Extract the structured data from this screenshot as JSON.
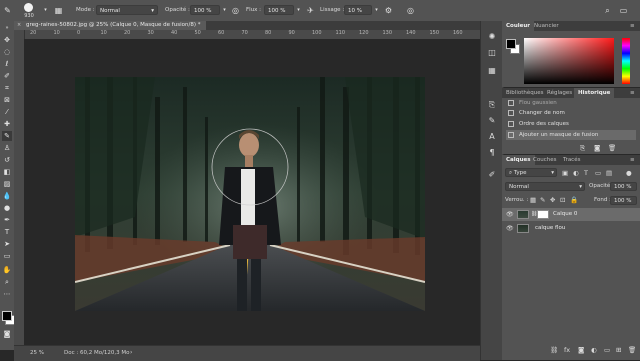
{
  "options_bar": {
    "brush_size": "930",
    "mode_label": "Mode :",
    "mode_value": "Normal",
    "opacity_label": "Opacité :",
    "opacity_value": "100 %",
    "flow_label": "Flux :",
    "flow_value": "100 %",
    "smoothing_label": "Lissage :",
    "smoothing_value": "10 %"
  },
  "document": {
    "tab_title": "greg-raines-50802.jpg @ 25% (Calque 0, Masque de fusion/8) *",
    "zoom": "25 %",
    "doc_info": "Doc : 60,2 Mo/120,3 Mo"
  },
  "ruler": {
    "ticks": [
      "20",
      "10",
      "0",
      "10",
      "20",
      "30",
      "40",
      "50",
      "60",
      "70",
      "80",
      "90",
      "100",
      "110",
      "120",
      "130",
      "140",
      "150",
      "160"
    ]
  },
  "color_panel": {
    "tabs": [
      "Couleur",
      "Nuancier"
    ],
    "hue_color": "#ff1a1a"
  },
  "history_panel": {
    "tabs": [
      "Bibliothèques",
      "Réglages",
      "Historique"
    ],
    "items": [
      "Flou gaussien",
      "Changer de nom",
      "Ordre des calques",
      "Ajouter un masque de fusion"
    ]
  },
  "layers_panel": {
    "tabs": [
      "Calques",
      "Couches",
      "Tracés"
    ],
    "filter_value": "Type",
    "blend_mode": "Normal",
    "opacity_label": "Opacité :",
    "opacity_value": "100 %",
    "lock_label": "Verrou. :",
    "fill_label": "Fond :",
    "fill_value": "100 %",
    "layers": [
      {
        "name": "Calque 0",
        "active": true,
        "has_mask": true
      },
      {
        "name": "calque flou",
        "active": false,
        "has_mask": false
      }
    ]
  },
  "colors": {
    "accent_swatch_fg": "#000000",
    "accent_swatch_bg": "#ffffff"
  }
}
